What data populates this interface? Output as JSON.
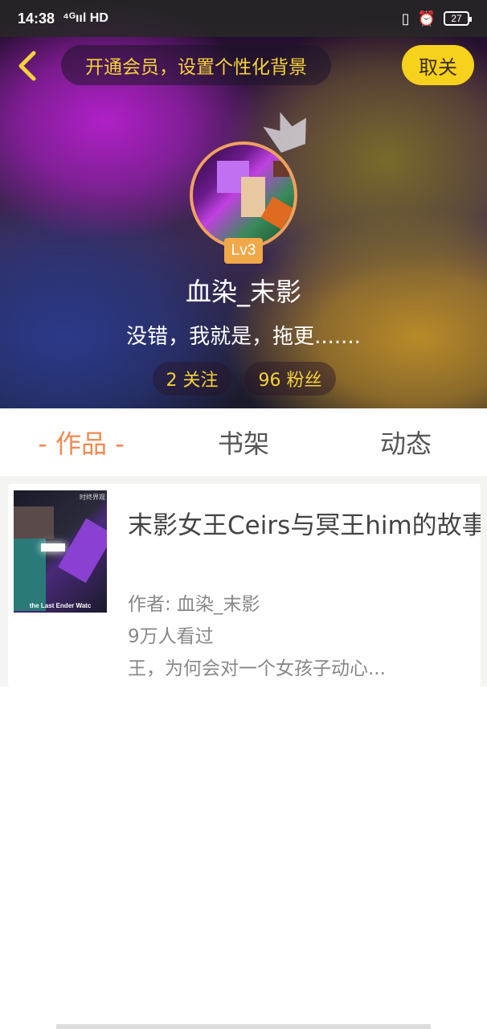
{
  "status_bar": {
    "time": "14:38",
    "network": "⁴ᴳııl HD",
    "battery": "27"
  },
  "header": {
    "back_icon": "chevron-left-icon",
    "vip_prompt": "开通会员，设置个性化背景",
    "follow_label": "取关"
  },
  "profile": {
    "level": "Lv3",
    "username": "血染_末影",
    "bio": "没错，我就是，拖更.......",
    "following": "2 关注",
    "fans": "96 粉丝"
  },
  "tabs": [
    {
      "label": "- 作品 -",
      "active": true
    },
    {
      "label": "书架",
      "active": false
    },
    {
      "label": "动态",
      "active": false
    }
  ],
  "works": [
    {
      "cover_caption": "the Last Ender Watc",
      "cover_top": "时终界观",
      "title": "末影女王Ceirs与冥王him的故事",
      "author": "作者: 血染_末影",
      "views": "9万人看过",
      "desc": "王，为何会对一个女孩子动心..."
    }
  ],
  "colors": {
    "accent": "#f6d23a",
    "follow_bg": "#f7d21c",
    "tab_active": "#f08a50",
    "level_bg": "#f0a848"
  }
}
